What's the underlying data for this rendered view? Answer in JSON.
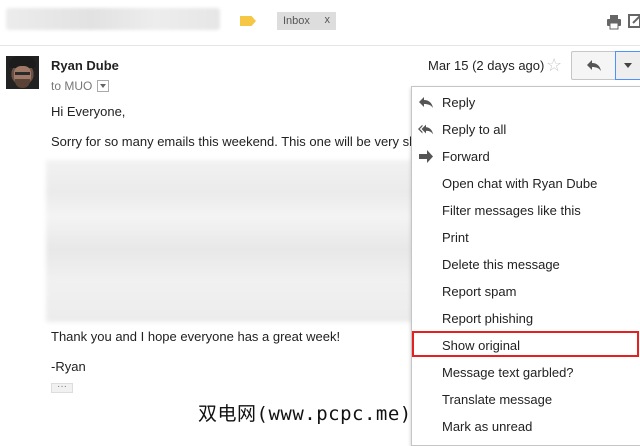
{
  "header": {
    "label_chip": "Inbox",
    "label_chip_remove": "x",
    "label_color": "#f5c744"
  },
  "message": {
    "sender_name": "Ryan Dube",
    "recipient_line": "to MUO",
    "date": "Mar 15 (2 days ago)",
    "greeting": "Hi Everyone,",
    "line1": "Sorry for so many emails this weekend. This one will be very sh",
    "closing": "Thank you and I hope everyone has a great week!",
    "signature": "-Ryan",
    "trimmed_content_label": "···"
  },
  "menu": {
    "items": [
      {
        "label": "Reply",
        "icon": "reply-icon"
      },
      {
        "label": "Reply to all",
        "icon": "reply-all-icon"
      },
      {
        "label": "Forward",
        "icon": "forward-icon"
      },
      {
        "label": "Open chat with Ryan Dube"
      },
      {
        "label": "Filter messages like this"
      },
      {
        "label": "Print"
      },
      {
        "label": "Delete this message"
      },
      {
        "label": "Report spam"
      },
      {
        "label": "Report phishing"
      },
      {
        "label": "Show original"
      },
      {
        "label": "Message text garbled?"
      },
      {
        "label": "Translate message"
      },
      {
        "label": "Mark as unread"
      }
    ],
    "highlight_color": "#e32121"
  },
  "watermark": "双电网(www.pcpc.me)"
}
